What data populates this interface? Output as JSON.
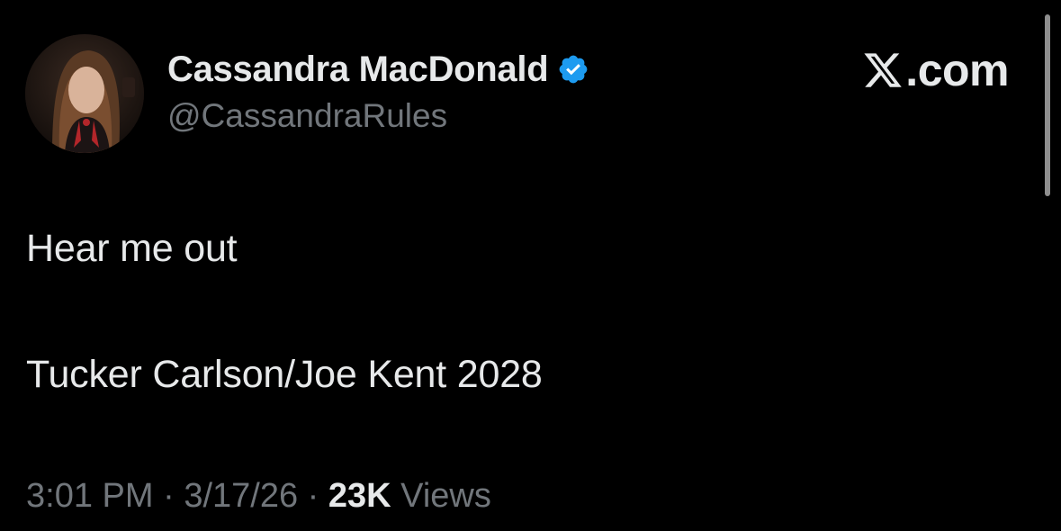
{
  "author": {
    "display_name": "Cassandra MacDonald",
    "handle": "@CassandraRules",
    "verified": true,
    "avatar_icon": "profile-photo",
    "verified_icon": "verified-badge-icon"
  },
  "brand": {
    "icon": "x-logo-icon",
    "text": ".com"
  },
  "tweet": {
    "lines": [
      "Hear me out",
      "Tucker Carlson/Joe Kent 2028"
    ]
  },
  "meta": {
    "time": "3:01 PM",
    "separator": "·",
    "date": "3/17/26",
    "views_count": "23K",
    "views_label": "Views"
  },
  "colors": {
    "background": "#000000",
    "primary_text": "#e7e9ea",
    "secondary_text": "#71767b",
    "verified_blue": "#1d9bf0"
  }
}
